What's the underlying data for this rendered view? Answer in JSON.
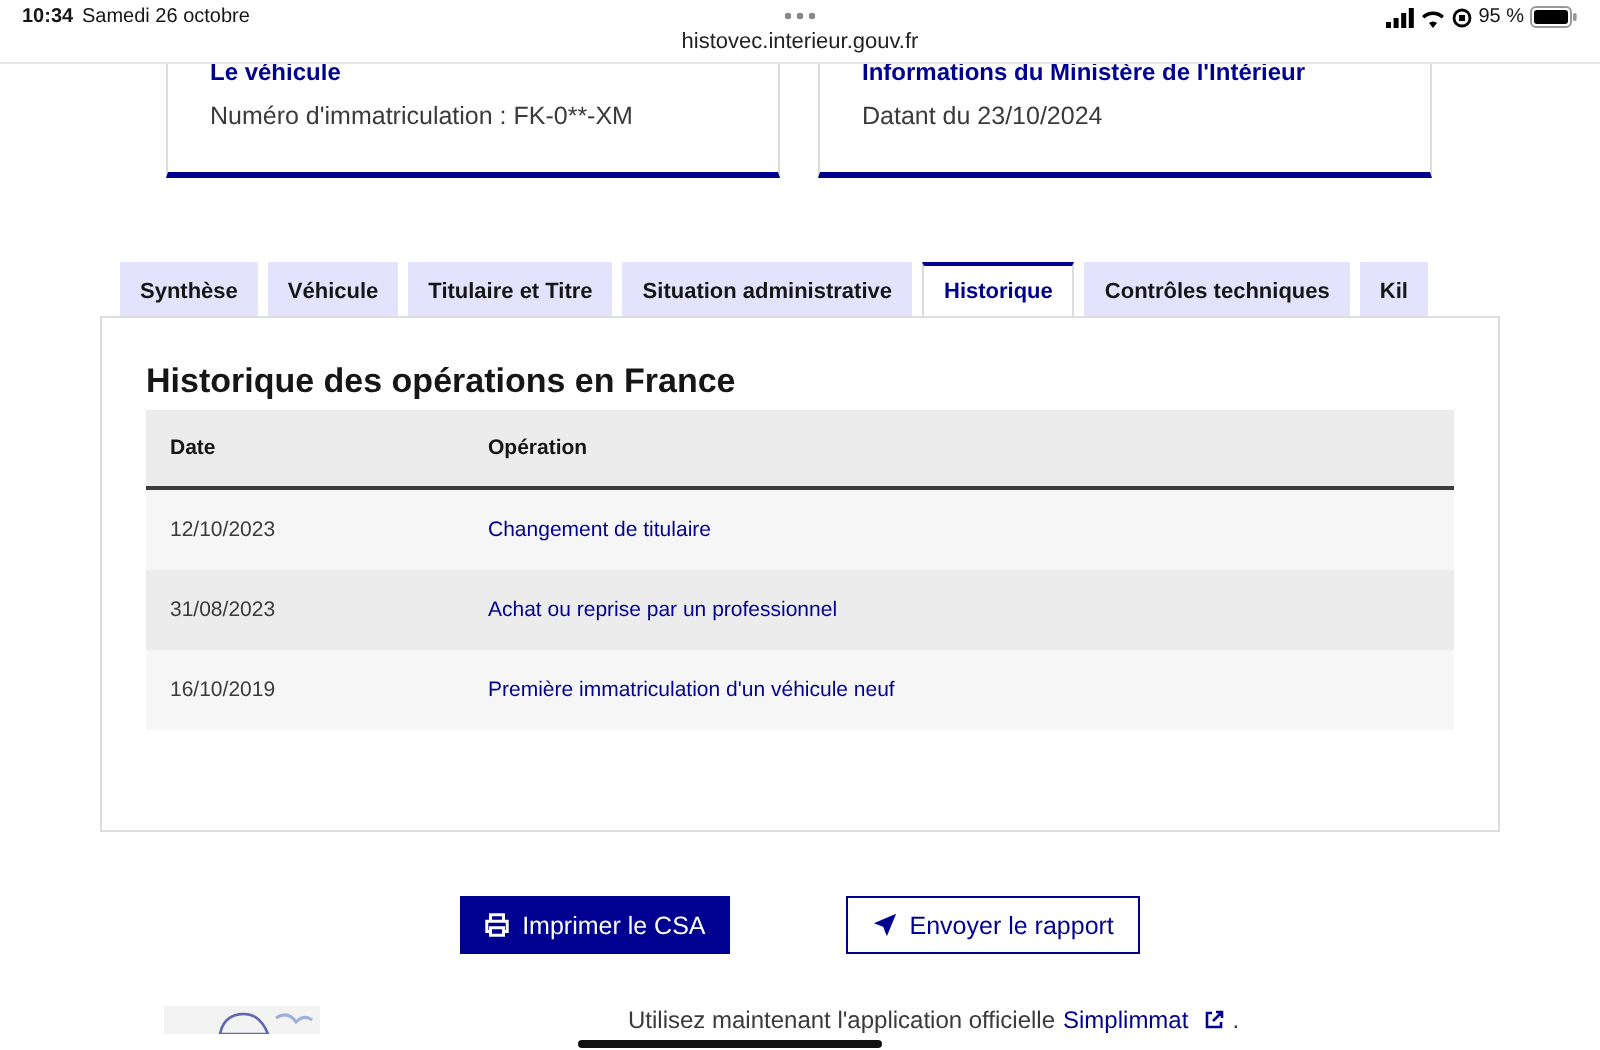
{
  "status_bar": {
    "time": "10:34",
    "date": "Samedi 26 octobre",
    "url": "histovec.interieur.gouv.fr",
    "battery": "95 %"
  },
  "cards": [
    {
      "title": "Le véhicule",
      "text": "Numéro d'immatriculation : FK-0**-XM"
    },
    {
      "title": "Informations du Ministère de l'Intérieur",
      "text": "Datant du 23/10/2024"
    }
  ],
  "tabs": [
    {
      "label": "Synthèse",
      "selected": false
    },
    {
      "label": "Véhicule",
      "selected": false
    },
    {
      "label": "Titulaire et Titre",
      "selected": false
    },
    {
      "label": "Situation administrative",
      "selected": false
    },
    {
      "label": "Historique",
      "selected": true
    },
    {
      "label": "Contrôles techniques",
      "selected": false
    },
    {
      "label": "Kil",
      "selected": false
    }
  ],
  "panel": {
    "title": "Historique des opérations en France",
    "table": {
      "columns": [
        "Date",
        "Opération"
      ],
      "rows": [
        [
          "12/10/2023",
          "Changement de titulaire"
        ],
        [
          "31/08/2023",
          "Achat ou reprise par un professionnel"
        ],
        [
          "16/10/2019",
          "Première immatriculation d'un véhicule neuf"
        ]
      ]
    }
  },
  "buttons": [
    {
      "label": "Imprimer le CSA",
      "kind": "primary"
    },
    {
      "label": "Envoyer le rapport",
      "kind": "secondary"
    }
  ],
  "footer": {
    "text": "Utilisez maintenant l'application officielle",
    "link": "Simplimmat",
    "end": "."
  }
}
